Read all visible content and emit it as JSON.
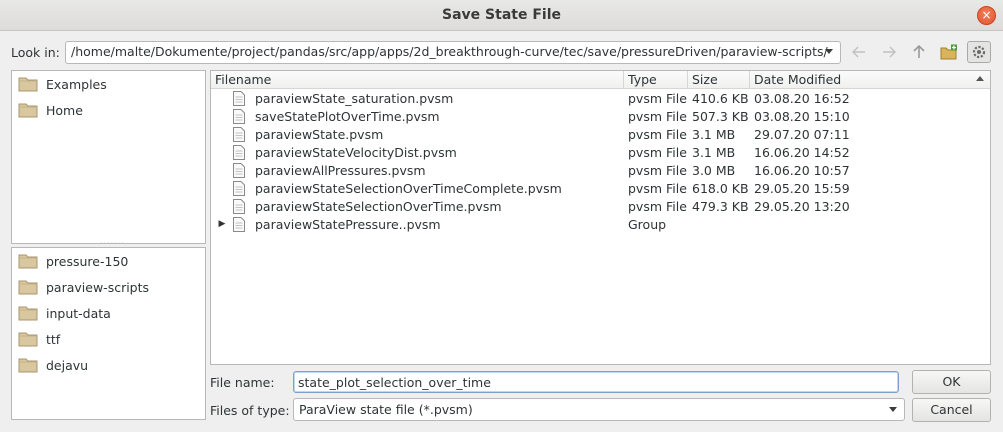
{
  "window": {
    "title": "Save State File",
    "close_glyph": "×"
  },
  "toolbar": {
    "look_in_label": "Look in:",
    "path": "/home/malte/Dokumente/project/pandas/src/app/apps/2d_breakthrough-curve/tec/save/pressureDriven/paraview-scripts/",
    "buttons": [
      "back-icon",
      "forward-icon",
      "parent-directory-icon",
      "new-folder-icon",
      "detail-view-icon"
    ]
  },
  "sidebar": {
    "places": [
      {
        "label": "Examples"
      },
      {
        "label": "Home"
      }
    ],
    "recent": [
      {
        "label": "pressure-150"
      },
      {
        "label": "paraview-scripts"
      },
      {
        "label": "input-data"
      },
      {
        "label": "ttf"
      },
      {
        "label": "dejavu"
      }
    ]
  },
  "file_list": {
    "headers": {
      "name": "Filename",
      "type": "Type",
      "size": "Size",
      "date": "Date Modified"
    },
    "rows": [
      {
        "name": "paraviewState_saturation.pvsm",
        "type": "pvsm File",
        "size": "410.6 KB",
        "date": "03.08.20 16:52",
        "expandable": false
      },
      {
        "name": "saveStatePlotOverTime.pvsm",
        "type": "pvsm File",
        "size": "507.3 KB",
        "date": "03.08.20 15:10",
        "expandable": false
      },
      {
        "name": "paraviewState.pvsm",
        "type": "pvsm File",
        "size": "3.1 MB",
        "date": "29.07.20 07:11",
        "expandable": false
      },
      {
        "name": "paraviewStateVelocityDist.pvsm",
        "type": "pvsm File",
        "size": "3.1 MB",
        "date": "16.06.20 14:52",
        "expandable": false
      },
      {
        "name": "paraviewAllPressures.pvsm",
        "type": "pvsm File",
        "size": "3.0 MB",
        "date": "16.06.20 10:57",
        "expandable": false
      },
      {
        "name": "paraviewStateSelectionOverTimeComplete.pvsm",
        "type": "pvsm File",
        "size": "618.0 KB",
        "date": "29.05.20 15:59",
        "expandable": false
      },
      {
        "name": "paraviewStateSelectionOverTime.pvsm",
        "type": "pvsm File",
        "size": "479.3 KB",
        "date": "29.05.20 13:20",
        "expandable": false
      },
      {
        "name": "paraviewStatePressure..pvsm",
        "type": "Group",
        "size": "",
        "date": "",
        "expandable": true
      }
    ]
  },
  "form": {
    "filename_label": "File name:",
    "filename_value": "state_plot_selection_over_time",
    "filetype_label": "Files of type:",
    "filetype_value": "ParaView state file (*.pvsm)",
    "ok_label": "OK",
    "cancel_label": "Cancel"
  },
  "colors": {
    "close": "#e2532f",
    "folder": "#d9c7a0",
    "accent_border": "#7ea1c9"
  }
}
